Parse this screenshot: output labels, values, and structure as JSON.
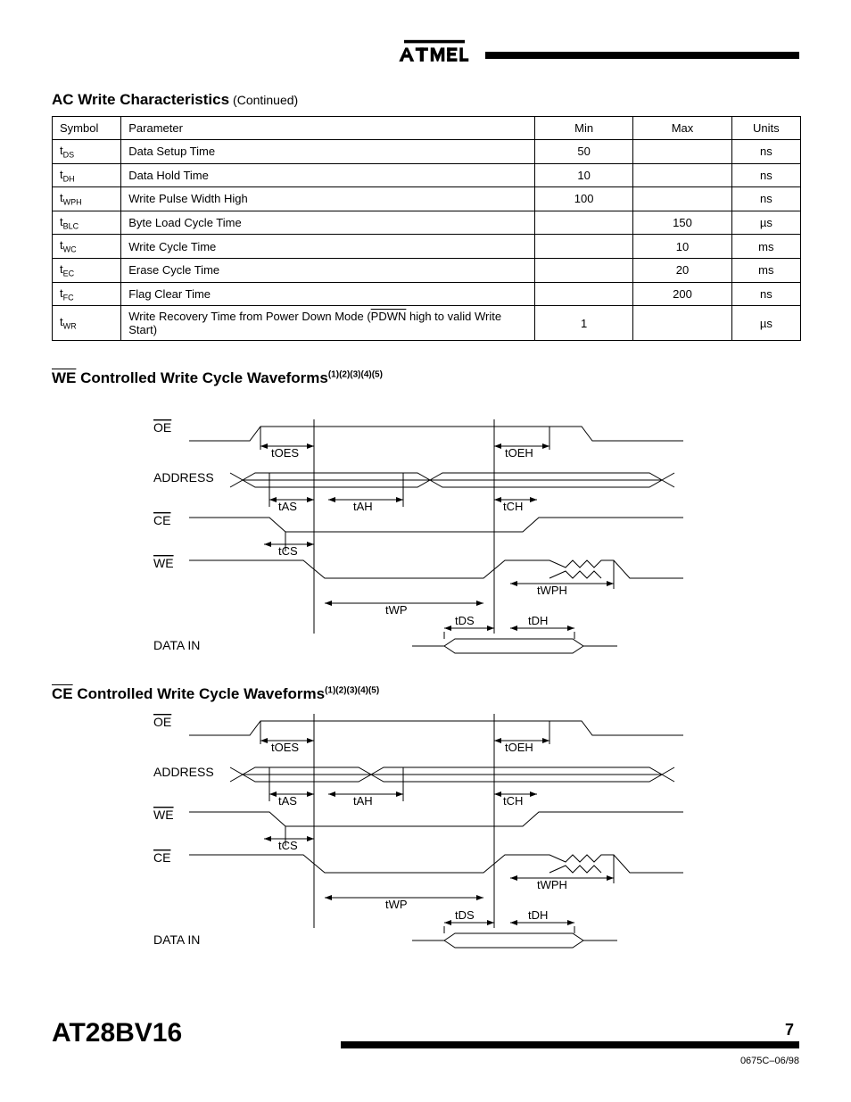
{
  "header": {
    "logo_alt": "ATMEL"
  },
  "title": {
    "main": "AC Write Characteristics",
    "sub": "(Continued)"
  },
  "table": {
    "headers": [
      "Symbol",
      "Parameter",
      "Min",
      "Max",
      "Units"
    ],
    "rows": [
      {
        "sym_t": "t",
        "sym_sub": "DS",
        "par": "Data Setup Time",
        "min": "50",
        "max": "",
        "units": "ns"
      },
      {
        "sym_t": "t",
        "sym_sub": "DH",
        "par": "Data Hold Time",
        "min": "10",
        "max": "",
        "units": "ns"
      },
      {
        "sym_t": "t",
        "sym_sub": "WPH",
        "par": "Write Pulse Width High",
        "min": "100",
        "max": "",
        "units": "ns"
      },
      {
        "sym_t": "t",
        "sym_sub": "BLC",
        "par": "Byte Load Cycle Time",
        "min": "",
        "max": "150",
        "units": "µs"
      },
      {
        "sym_t": "t",
        "sym_sub": "WC",
        "par": "Write Cycle Time",
        "min": "",
        "max": "10",
        "units": "ms"
      },
      {
        "sym_t": "t",
        "sym_sub": "EC",
        "par": "Erase Cycle Time",
        "min": "",
        "max": "20",
        "units": "ms"
      },
      {
        "sym_t": "t",
        "sym_sub": "FC",
        "par": "Flag Clear Time",
        "min": "",
        "max": "200",
        "units": "ns"
      },
      {
        "sym_t": "t",
        "sym_sub": "WR",
        "par_pre": "Write Recovery Time from Power Down Mode (",
        "par_ovl": "PDWN",
        "par_post": " high to valid Write Start)",
        "min": "1",
        "max": "",
        "units": "µs"
      }
    ]
  },
  "sec1": {
    "prefix": "",
    "ovl": "WE",
    "suffix": " Controlled Write Cycle Waveforms",
    "sup": "(1)(2)(3)(4)(5)"
  },
  "sec2": {
    "prefix": "",
    "ovl": "CE",
    "suffix": " Controlled Write Cycle Waveforms",
    "sup": "(1)(2)(3)(4)(5)"
  },
  "labels": {
    "OE": "OE",
    "ADDRESS": "ADDRESS",
    "CE": "CE",
    "WE": "WE",
    "DATA": "DATA",
    "IN": "IN",
    "tOES": "tOES",
    "tOEH": "tOEH",
    "tAS": "tAS",
    "tAH": "tAH",
    "tCH": "tCH",
    "tCS": "tCS",
    "tWP": "tWP",
    "tWPH": "tWPH",
    "tDS": "tDS",
    "tDH": "tDH"
  },
  "footer": {
    "chip": "AT28BV16",
    "doc": "0675C–06/98",
    "page": "7"
  }
}
